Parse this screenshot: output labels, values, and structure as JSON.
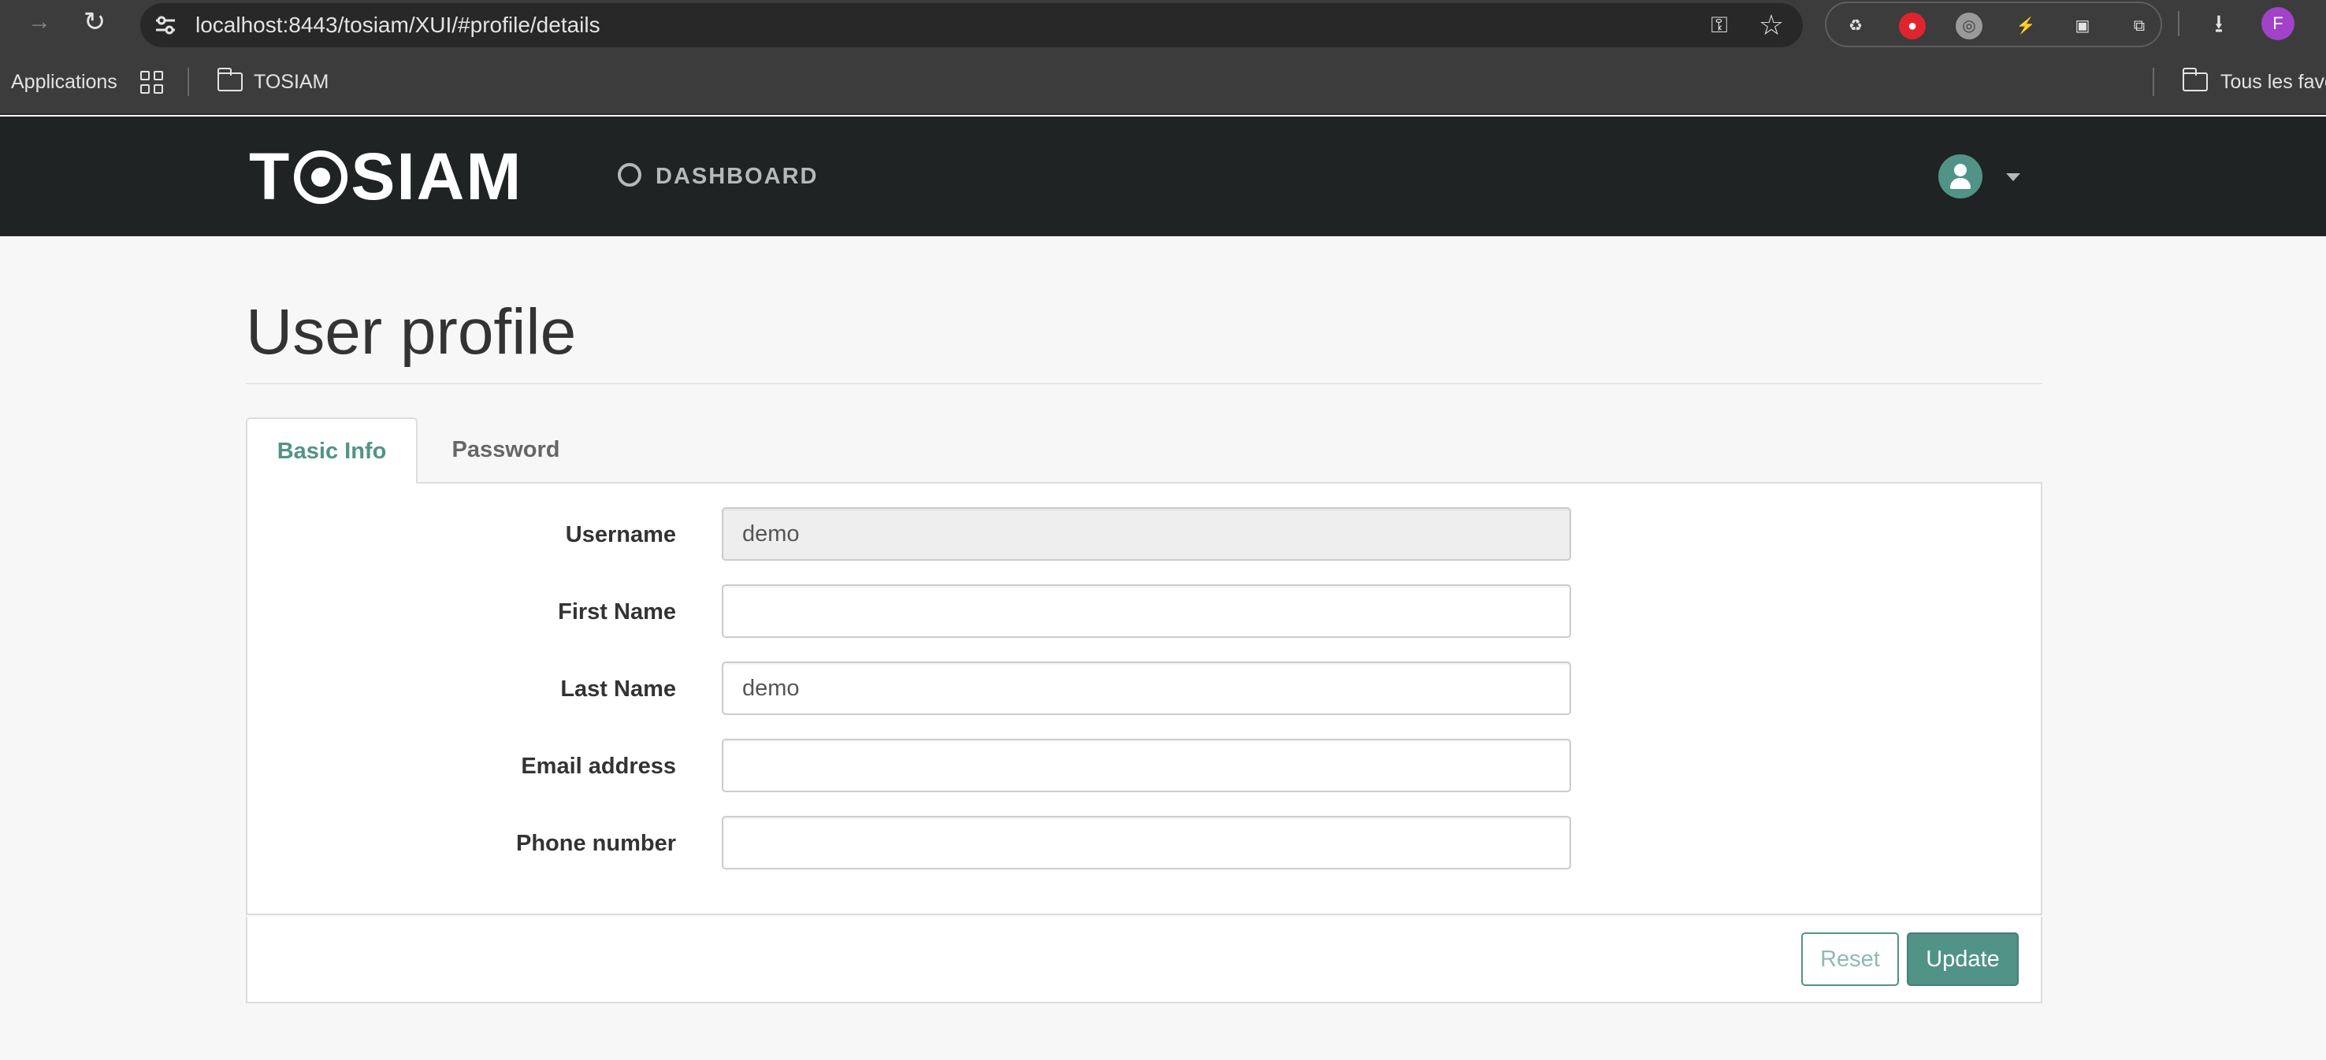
{
  "browser": {
    "url": "localhost:8443/tosiam/XUI/#profile/details",
    "profile_initial": "F",
    "bookmarks": {
      "applications": "Applications",
      "folder": "TOSIAM",
      "all_bookmarks": "Tous les favo"
    }
  },
  "header": {
    "logo_left": "T",
    "logo_right": "SIAM",
    "dashboard_label": "DASHBOARD"
  },
  "page": {
    "title": "User profile"
  },
  "tabs": [
    {
      "label": "Basic Info",
      "active": true
    },
    {
      "label": "Password",
      "active": false
    }
  ],
  "form": {
    "username": {
      "label": "Username",
      "value": "demo"
    },
    "first_name": {
      "label": "First Name",
      "value": ""
    },
    "last_name": {
      "label": "Last Name",
      "value": "demo"
    },
    "email": {
      "label": "Email address",
      "value": ""
    },
    "phone": {
      "label": "Phone number",
      "value": ""
    }
  },
  "buttons": {
    "reset": "Reset",
    "update": "Update"
  },
  "colors": {
    "accent": "#519387",
    "header_bg": "#1f2323",
    "page_bg": "#f7f7f7"
  }
}
